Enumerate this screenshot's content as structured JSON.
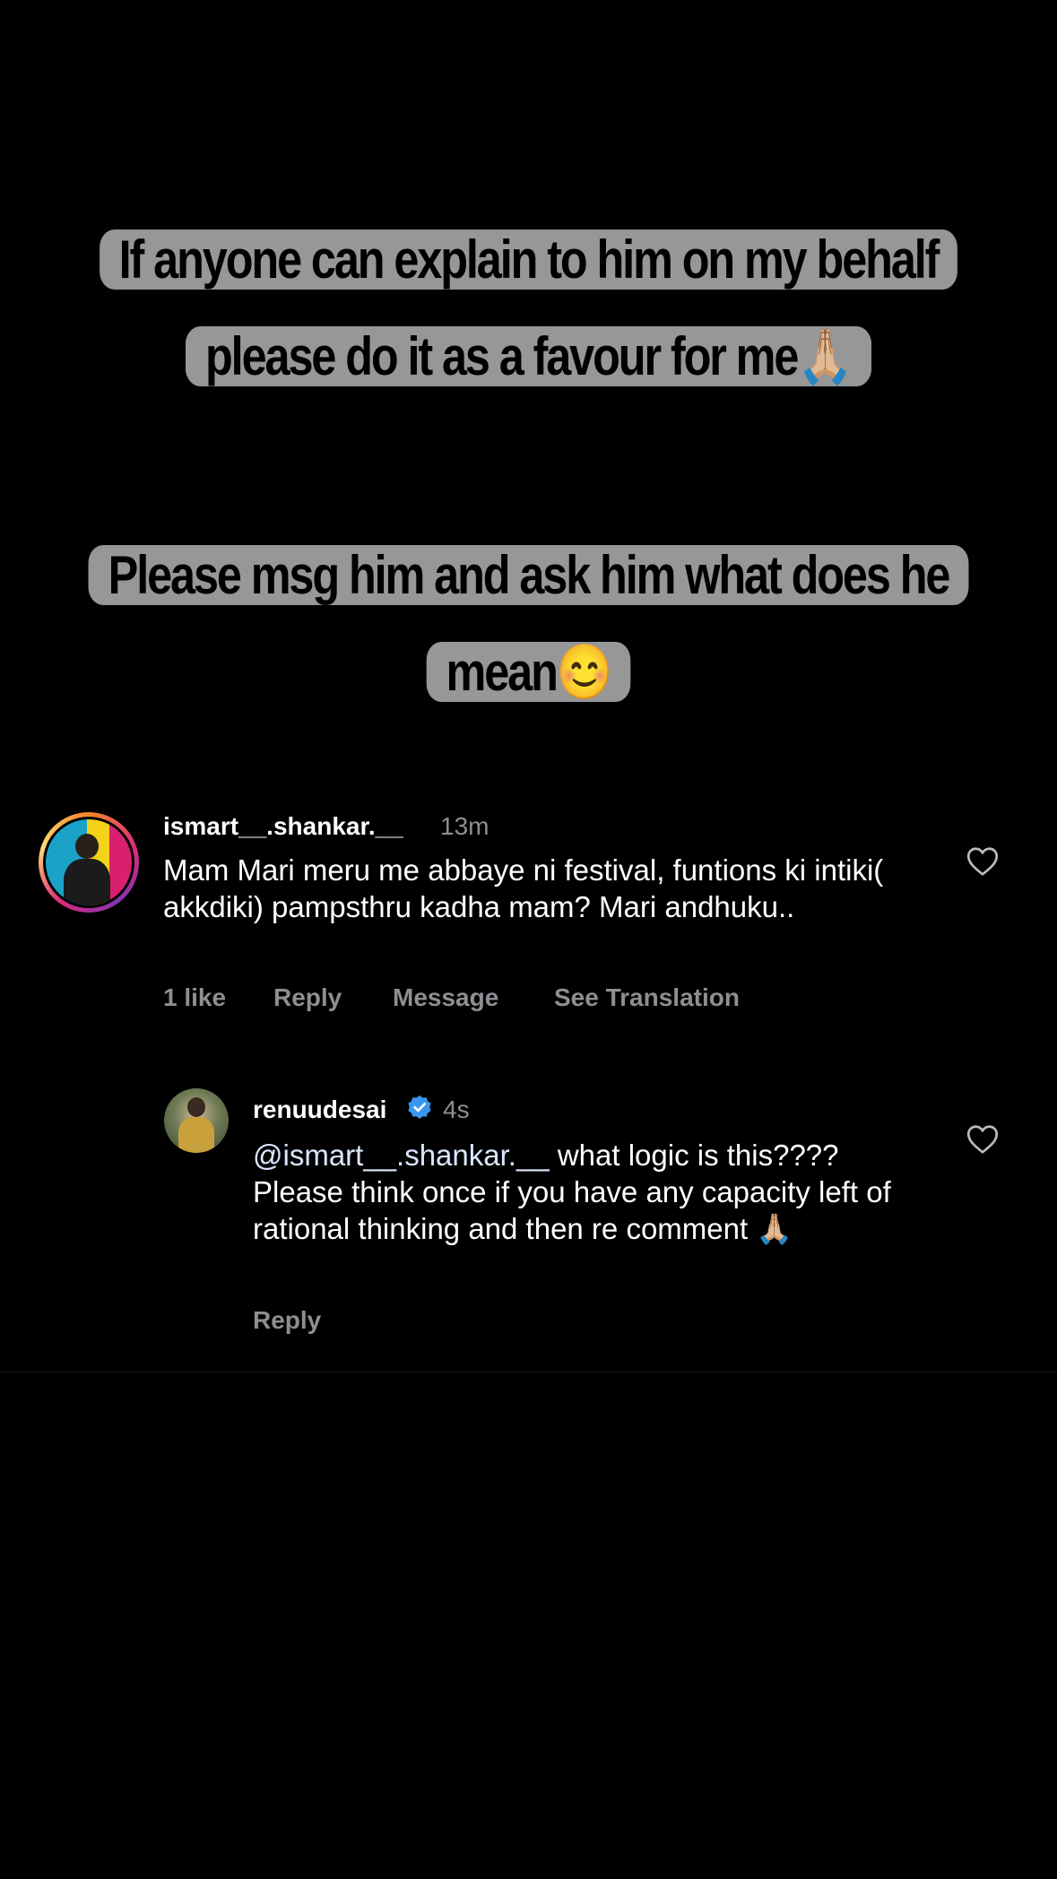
{
  "story": {
    "caption_1": "If anyone can explain to him on my behalf please do it as a favour for me🙏🏼",
    "caption_2": "Please msg him and ask him what does he mean😊"
  },
  "comments": [
    {
      "username": "ismart__.shankar.__",
      "time": "13m",
      "text": "Mam Mari meru me abbaye ni festival, funtions ki intiki( akkdiki) pampsthru kadha mam?  Mari andhuku..",
      "likes": "1 like",
      "reply_label": "Reply",
      "message_label": "Message",
      "translate_label": "See Translation",
      "icons": {
        "like": "heart-outline-icon"
      }
    },
    {
      "username": "renuudesai",
      "verified": true,
      "time": "4s",
      "mention": "@ismart__.shankar.__",
      "text": " what logic is this???? Please think once if you have any capacity left of rational thinking and then re comment 🙏🏼",
      "reply_label": "Reply",
      "icons": {
        "like": "heart-outline-icon",
        "verified": "verified-badge-icon"
      }
    }
  ],
  "colors": {
    "background": "#000000",
    "caption_highlight": "#979797",
    "muted_text": "#8e8e93",
    "verified_blue": "#3897f0"
  }
}
